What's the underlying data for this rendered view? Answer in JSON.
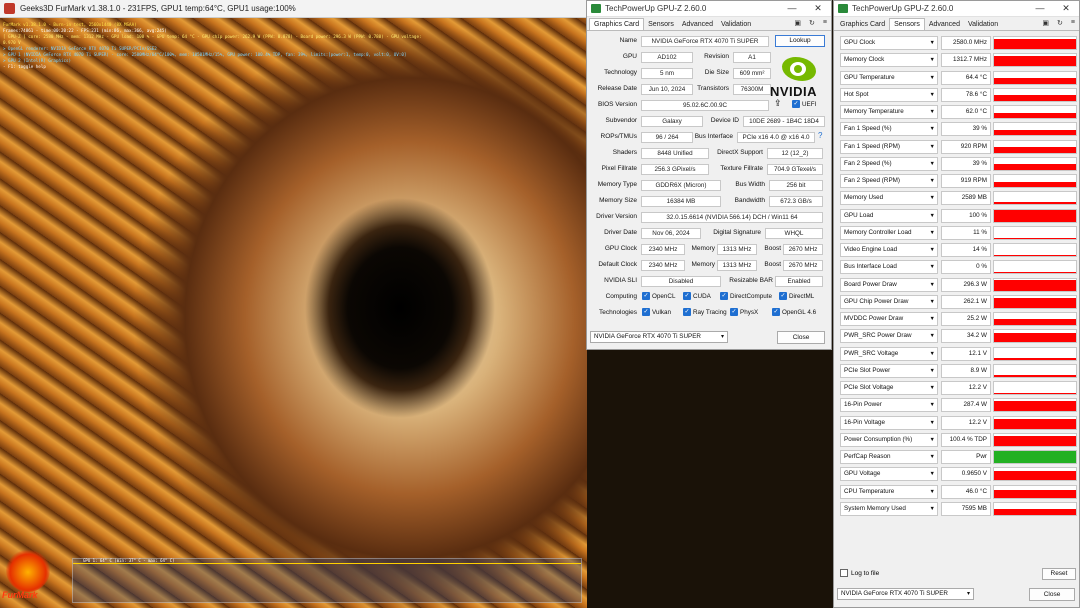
{
  "furmark": {
    "title": "Geeks3D FurMark v1.38.1.0 - 231FPS, GPU1 temp:64°C, GPU1 usage:100%",
    "overlay": [
      "FurMark v1.38.1.0 - Burn-in test, 2560x1440 (8X MSAA)",
      "Frames:74861 - time:00:20:22 - FPS:231 (min:86, max:366, avg:245)",
      "[ GPU-Z ] core: 2580 MHz - mem: 1312 MHz - GPU load: 100 % - GPU temp: 64 °C - GPU chip power: 262.9 W (PPW: 0.878) - Board power: 296.3 W (PPW: 0.780) - GPU voltage: 0.970 V",
      "> OpenGL renderer: NVIDIA GeForce RTX 4070 Ti SUPER/PCIe/SSE2",
      "> GPU 1 (NVIDIA GeForce RTX 4070 Ti SUPER) - core: 2580MHz/64°C/100%, mem: 10501MHz/15%, GPU power: 100.4% TDP, fan: 39%, limits:[power:1, temp:0, volt:0, OV:0]",
      "> GPU 2 (Intel(R) Graphics)",
      "- F1: toggle help"
    ],
    "graph_label": "GPU 1: 64° C (min: 37° C - max: 64° C)",
    "logo_text": "FurMark"
  },
  "gpuz1": {
    "title": "TechPowerUp GPU-Z 2.60.0",
    "tabs": [
      "Graphics Card",
      "Sensors",
      "Advanced",
      "Validation"
    ],
    "fields": {
      "name_label": "Name",
      "name": "NVIDIA GeForce RTX 4070 Ti SUPER",
      "lookup": "Lookup",
      "gpu_label": "GPU",
      "gpu": "AD102",
      "revision_label": "Revision",
      "revision": "A1",
      "tech_label": "Technology",
      "tech": "5 nm",
      "diesize_label": "Die Size",
      "diesize": "609 mm²",
      "release_label": "Release Date",
      "release": "Jun 10, 2024",
      "transistors_label": "Transistors",
      "transistors": "76300M",
      "bios_label": "BIOS Version",
      "bios": "95.02.6C.00.9C",
      "uefi": "UEFI",
      "subvendor_label": "Subvendor",
      "subvendor": "Galaxy",
      "deviceid_label": "Device ID",
      "deviceid": "10DE 2689 - 1B4C 18D4",
      "rops_label": "ROPs/TMUs",
      "rops": "96 / 264",
      "busif_label": "Bus Interface",
      "busif": "PCIe x16 4.0 @ x16 4.0",
      "shaders_label": "Shaders",
      "shaders": "8448 Unified",
      "dx_label": "DirectX Support",
      "dx": "12 (12_2)",
      "pixel_label": "Pixel Fillrate",
      "pixel": "256.3 GPixel/s",
      "texture_label": "Texture Fillrate",
      "texture": "704.9 GTexel/s",
      "memtype_label": "Memory Type",
      "memtype": "GDDR6X (Micron)",
      "buswidth_label": "Bus Width",
      "buswidth": "256 bit",
      "memsize_label": "Memory Size",
      "memsize": "16384 MB",
      "bandwidth_label": "Bandwidth",
      "bandwidth": "672.3 GB/s",
      "driver_label": "Driver Version",
      "driver": "32.0.15.6614 (NVIDIA 566.14) DCH / Win11 64",
      "driverdate_label": "Driver Date",
      "driverdate": "Nov 06, 2024",
      "digsig_label": "Digital Signature",
      "digsig": "WHQL",
      "gpuclock_label": "GPU Clock",
      "gpuclock": "2340 MHz",
      "memory_label": "Memory",
      "memory": "1313 MHz",
      "boost_label": "Boost",
      "boost": "2670 MHz",
      "defclock_label": "Default Clock",
      "defclock": "2340 MHz",
      "memory2": "1313 MHz",
      "boost2": "2670 MHz",
      "sli_label": "NVIDIA SLI",
      "sli": "Disabled",
      "rebar_label": "Resizable BAR",
      "rebar": "Enabled",
      "computing_label": "Computing",
      "computing": [
        "OpenCL",
        "CUDA",
        "DirectCompute",
        "DirectML"
      ],
      "technologies_label": "Technologies",
      "technologies": [
        "Vulkan",
        "Ray Tracing",
        "PhysX",
        "OpenGL 4.6"
      ]
    },
    "logo_text": "NVIDIA",
    "gpu_select": "NVIDIA GeForce RTX 4070 Ti SUPER",
    "close": "Close"
  },
  "gpuz2": {
    "title": "TechPowerUp GPU-Z 2.60.0",
    "tabs": [
      "Graphics Card",
      "Sensors",
      "Advanced",
      "Validation"
    ],
    "sensors": [
      {
        "name": "GPU Clock",
        "value": "2580.0 MHz",
        "fill": 0.85,
        "color": "#ff0000"
      },
      {
        "name": "Memory Clock",
        "value": "1312.7 MHz",
        "fill": 0.85,
        "color": "#ff0000"
      },
      {
        "name": "GPU Temperature",
        "value": "64.4 °C",
        "fill": 0.5,
        "color": "#ff0000"
      },
      {
        "name": "Hot Spot",
        "value": "78.6 °C",
        "fill": 0.5,
        "color": "#ff0000"
      },
      {
        "name": "Memory Temperature",
        "value": "62.0 °C",
        "fill": 0.45,
        "color": "#ff0000"
      },
      {
        "name": "Fan 1 Speed (%)",
        "value": "39 %",
        "fill": 0.45,
        "color": "#ff0000"
      },
      {
        "name": "Fan 1 Speed (RPM)",
        "value": "920 RPM",
        "fill": 0.45,
        "color": "#ff0000"
      },
      {
        "name": "Fan 2 Speed (%)",
        "value": "39 %",
        "fill": 0.45,
        "color": "#ff0000"
      },
      {
        "name": "Fan 2 Speed (RPM)",
        "value": "919 RPM",
        "fill": 0.45,
        "color": "#ff0000"
      },
      {
        "name": "Memory Used",
        "value": "2589 MB",
        "fill": 0.2,
        "color": "#ff0000"
      },
      {
        "name": "GPU Load",
        "value": "100 %",
        "fill": 1.0,
        "color": "#ff0000"
      },
      {
        "name": "Memory Controller Load",
        "value": "11 %",
        "fill": 0.1,
        "color": "#ff0000"
      },
      {
        "name": "Video Engine Load",
        "value": "14 %",
        "fill": 0.1,
        "color": "#ff0000"
      },
      {
        "name": "Bus Interface Load",
        "value": "0 %",
        "fill": 0.0,
        "color": "#ff0000"
      },
      {
        "name": "Board Power Draw",
        "value": "296.3 W",
        "fill": 0.85,
        "color": "#ff0000"
      },
      {
        "name": "GPU Chip Power Draw",
        "value": "262.1 W",
        "fill": 0.8,
        "color": "#ff0000"
      },
      {
        "name": "MVDDC Power Draw",
        "value": "25.2 W",
        "fill": 0.5,
        "color": "#ff0000"
      },
      {
        "name": "PWR_SRC Power Draw",
        "value": "34.2 W",
        "fill": 0.8,
        "color": "#ff0000"
      },
      {
        "name": "PWR_SRC Voltage",
        "value": "12.1 V",
        "fill": 0.1,
        "color": "#ff0000"
      },
      {
        "name": "PCIe Slot Power",
        "value": "8.9 W",
        "fill": 0.15,
        "color": "#ff0000"
      },
      {
        "name": "PCIe Slot Voltage",
        "value": "12.2 V",
        "fill": 0.1,
        "color": "#ff0000"
      },
      {
        "name": "16-Pin Power",
        "value": "287.4 W",
        "fill": 0.85,
        "color": "#ff0000"
      },
      {
        "name": "16-Pin Voltage",
        "value": "12.2 V",
        "fill": 0.8,
        "color": "#ff0000"
      },
      {
        "name": "Power Consumption (%)",
        "value": "100.4 % TDP",
        "fill": 0.8,
        "color": "#ff0000"
      },
      {
        "name": "PerfCap Reason",
        "value": "Pwr",
        "fill": 1.0,
        "color": "#22b022"
      },
      {
        "name": "GPU Voltage",
        "value": "0.9650 V",
        "fill": 0.8,
        "color": "#ff0000"
      },
      {
        "name": "CPU Temperature",
        "value": "46.0 °C",
        "fill": 0.6,
        "color": "#ff0000"
      },
      {
        "name": "System Memory Used",
        "value": "7595 MB",
        "fill": 0.5,
        "color": "#ff0000"
      }
    ],
    "log_label": "Log to file",
    "reset": "Reset",
    "gpu_select": "NVIDIA GeForce RTX 4070 Ti SUPER",
    "close": "Close"
  }
}
